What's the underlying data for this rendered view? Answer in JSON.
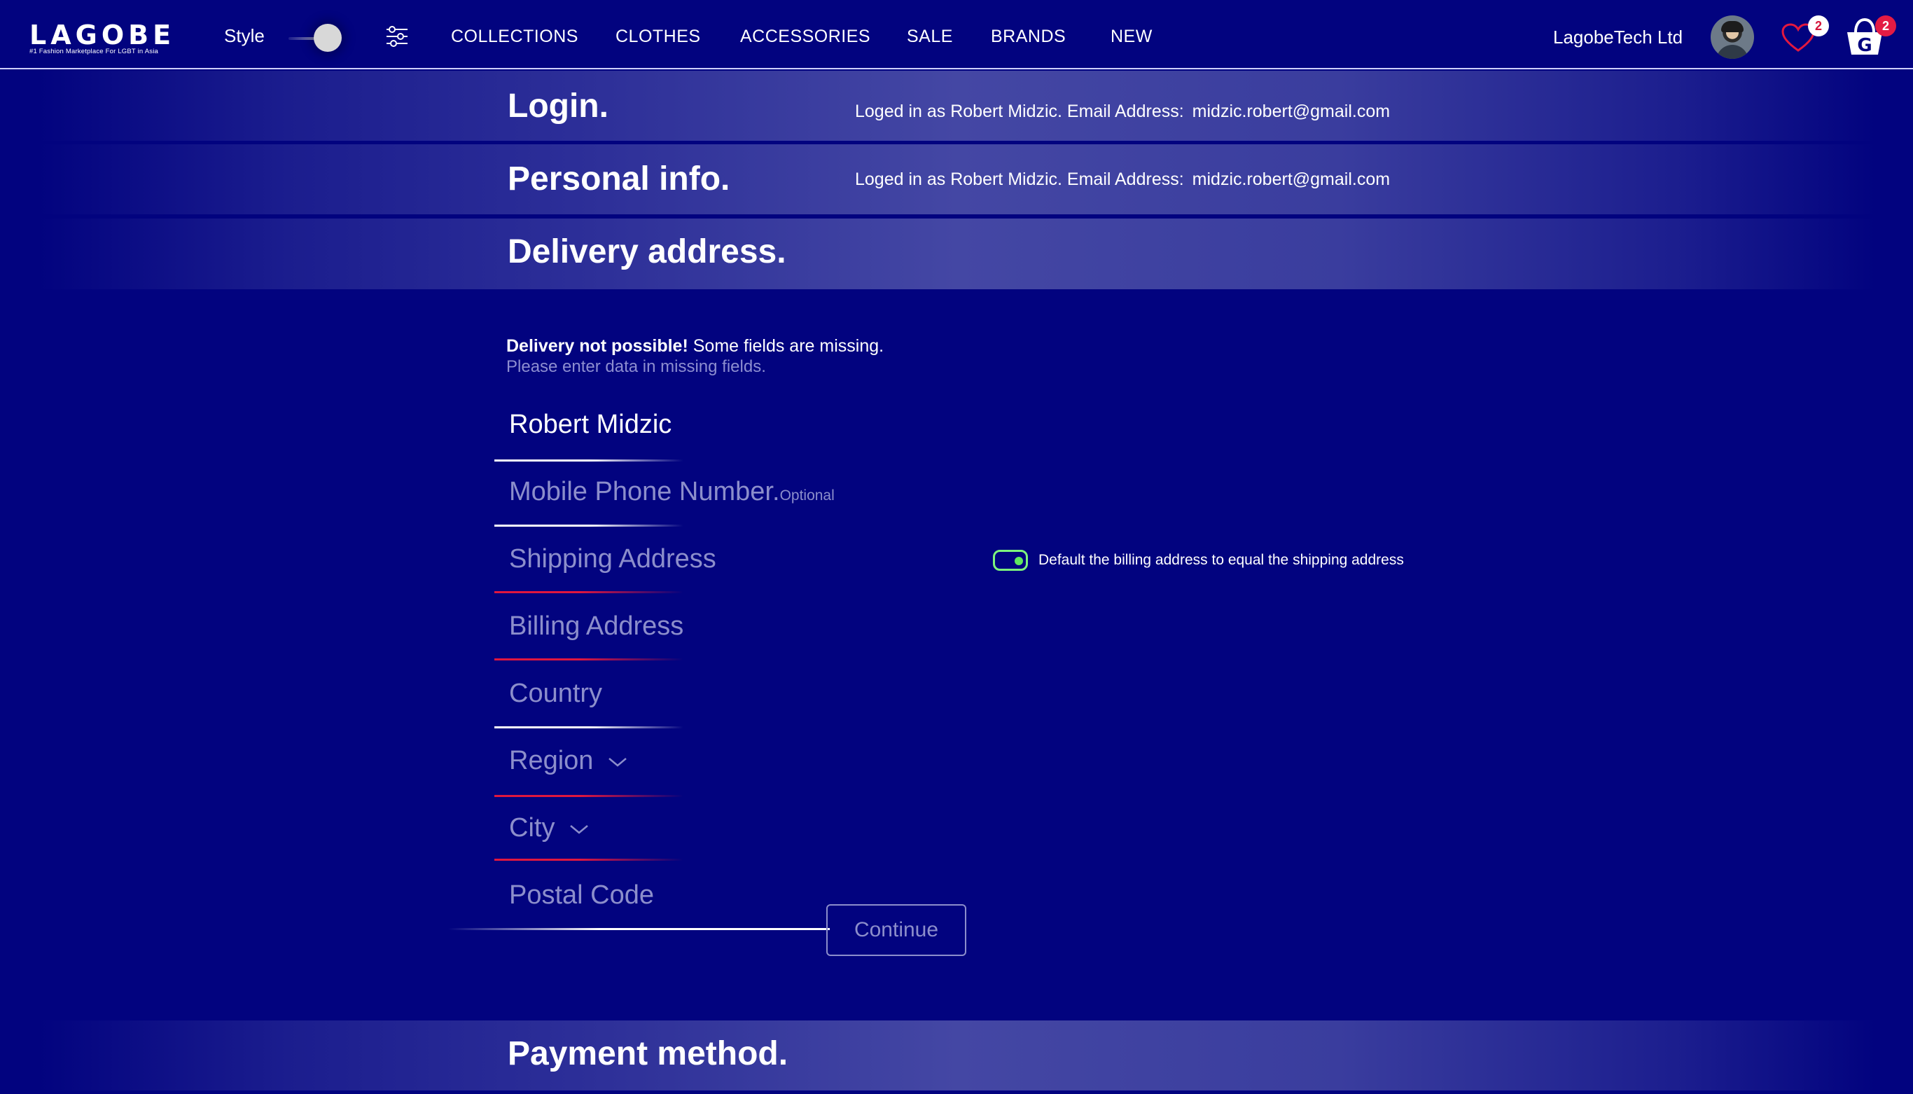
{
  "header": {
    "logo_text": "LAGOBE",
    "logo_tagline": "#1 Fashion Marketplace For LGBT in Asia",
    "style_label": "Style",
    "nav": [
      "COLLECTIONS",
      "CLOTHES",
      "ACCESSORIES",
      "SALE",
      "BRANDS",
      "NEW"
    ],
    "company_name": "LagobeTech Ltd",
    "wishlist_count": "2",
    "cart_count": "2",
    "icons": [
      "filter-sliders-icon",
      "heart-icon",
      "shopping-cart-icon"
    ]
  },
  "sections": {
    "login": {
      "title": "Login.",
      "info_prefix": "Loged in as Robert Midzic. Email Address:",
      "email": "midzic.robert@gmail.com"
    },
    "personal": {
      "title": "Personal info.",
      "info_prefix": "Loged in as Robert Midzic. Email Address:",
      "email": "midzic.robert@gmail.com"
    },
    "delivery": {
      "title": "Delivery address."
    },
    "payment": {
      "title": "Payment method."
    }
  },
  "form": {
    "warning_bold": "Delivery not possible!",
    "warning_text": " Some fields are missing.",
    "warning_sub": "Please enter data in missing fields.",
    "name_value": "Robert Midzic",
    "phone_placeholder": "Mobile Phone Number.",
    "phone_optional": "Optional",
    "shipping_placeholder": "Shipping Address",
    "billing_placeholder": "Billing Address",
    "country_placeholder": "Country",
    "region_placeholder": "Region",
    "city_placeholder": "City",
    "postal_placeholder": "Postal Code",
    "continue_label": "Continue",
    "billing_toggle_label": "Default the billing address to equal the shipping address",
    "billing_toggle_on": true
  },
  "colors": {
    "background": "#02037f",
    "placeholder": "#8c8ecb",
    "error_line": "#e0173f",
    "toggle_green": "#5fe85f",
    "badge_red": "#e31b44"
  }
}
